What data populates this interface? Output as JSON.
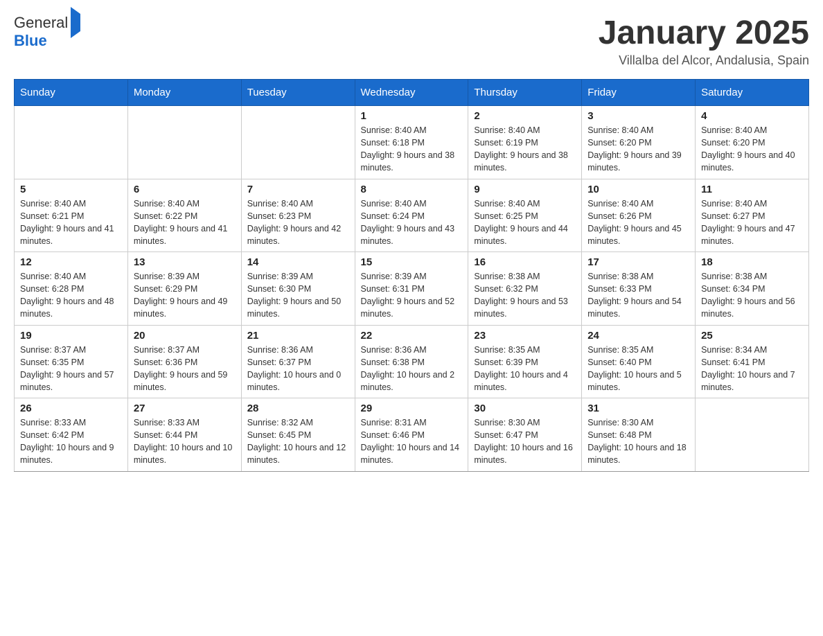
{
  "header": {
    "logo_text_general": "General",
    "logo_text_blue": "Blue",
    "month_title": "January 2025",
    "location": "Villalba del Alcor, Andalusia, Spain"
  },
  "days_of_week": [
    "Sunday",
    "Monday",
    "Tuesday",
    "Wednesday",
    "Thursday",
    "Friday",
    "Saturday"
  ],
  "weeks": [
    [
      {
        "day": "",
        "info": ""
      },
      {
        "day": "",
        "info": ""
      },
      {
        "day": "",
        "info": ""
      },
      {
        "day": "1",
        "info": "Sunrise: 8:40 AM\nSunset: 6:18 PM\nDaylight: 9 hours and 38 minutes."
      },
      {
        "day": "2",
        "info": "Sunrise: 8:40 AM\nSunset: 6:19 PM\nDaylight: 9 hours and 38 minutes."
      },
      {
        "day": "3",
        "info": "Sunrise: 8:40 AM\nSunset: 6:20 PM\nDaylight: 9 hours and 39 minutes."
      },
      {
        "day": "4",
        "info": "Sunrise: 8:40 AM\nSunset: 6:20 PM\nDaylight: 9 hours and 40 minutes."
      }
    ],
    [
      {
        "day": "5",
        "info": "Sunrise: 8:40 AM\nSunset: 6:21 PM\nDaylight: 9 hours and 41 minutes."
      },
      {
        "day": "6",
        "info": "Sunrise: 8:40 AM\nSunset: 6:22 PM\nDaylight: 9 hours and 41 minutes."
      },
      {
        "day": "7",
        "info": "Sunrise: 8:40 AM\nSunset: 6:23 PM\nDaylight: 9 hours and 42 minutes."
      },
      {
        "day": "8",
        "info": "Sunrise: 8:40 AM\nSunset: 6:24 PM\nDaylight: 9 hours and 43 minutes."
      },
      {
        "day": "9",
        "info": "Sunrise: 8:40 AM\nSunset: 6:25 PM\nDaylight: 9 hours and 44 minutes."
      },
      {
        "day": "10",
        "info": "Sunrise: 8:40 AM\nSunset: 6:26 PM\nDaylight: 9 hours and 45 minutes."
      },
      {
        "day": "11",
        "info": "Sunrise: 8:40 AM\nSunset: 6:27 PM\nDaylight: 9 hours and 47 minutes."
      }
    ],
    [
      {
        "day": "12",
        "info": "Sunrise: 8:40 AM\nSunset: 6:28 PM\nDaylight: 9 hours and 48 minutes."
      },
      {
        "day": "13",
        "info": "Sunrise: 8:39 AM\nSunset: 6:29 PM\nDaylight: 9 hours and 49 minutes."
      },
      {
        "day": "14",
        "info": "Sunrise: 8:39 AM\nSunset: 6:30 PM\nDaylight: 9 hours and 50 minutes."
      },
      {
        "day": "15",
        "info": "Sunrise: 8:39 AM\nSunset: 6:31 PM\nDaylight: 9 hours and 52 minutes."
      },
      {
        "day": "16",
        "info": "Sunrise: 8:38 AM\nSunset: 6:32 PM\nDaylight: 9 hours and 53 minutes."
      },
      {
        "day": "17",
        "info": "Sunrise: 8:38 AM\nSunset: 6:33 PM\nDaylight: 9 hours and 54 minutes."
      },
      {
        "day": "18",
        "info": "Sunrise: 8:38 AM\nSunset: 6:34 PM\nDaylight: 9 hours and 56 minutes."
      }
    ],
    [
      {
        "day": "19",
        "info": "Sunrise: 8:37 AM\nSunset: 6:35 PM\nDaylight: 9 hours and 57 minutes."
      },
      {
        "day": "20",
        "info": "Sunrise: 8:37 AM\nSunset: 6:36 PM\nDaylight: 9 hours and 59 minutes."
      },
      {
        "day": "21",
        "info": "Sunrise: 8:36 AM\nSunset: 6:37 PM\nDaylight: 10 hours and 0 minutes."
      },
      {
        "day": "22",
        "info": "Sunrise: 8:36 AM\nSunset: 6:38 PM\nDaylight: 10 hours and 2 minutes."
      },
      {
        "day": "23",
        "info": "Sunrise: 8:35 AM\nSunset: 6:39 PM\nDaylight: 10 hours and 4 minutes."
      },
      {
        "day": "24",
        "info": "Sunrise: 8:35 AM\nSunset: 6:40 PM\nDaylight: 10 hours and 5 minutes."
      },
      {
        "day": "25",
        "info": "Sunrise: 8:34 AM\nSunset: 6:41 PM\nDaylight: 10 hours and 7 minutes."
      }
    ],
    [
      {
        "day": "26",
        "info": "Sunrise: 8:33 AM\nSunset: 6:42 PM\nDaylight: 10 hours and 9 minutes."
      },
      {
        "day": "27",
        "info": "Sunrise: 8:33 AM\nSunset: 6:44 PM\nDaylight: 10 hours and 10 minutes."
      },
      {
        "day": "28",
        "info": "Sunrise: 8:32 AM\nSunset: 6:45 PM\nDaylight: 10 hours and 12 minutes."
      },
      {
        "day": "29",
        "info": "Sunrise: 8:31 AM\nSunset: 6:46 PM\nDaylight: 10 hours and 14 minutes."
      },
      {
        "day": "30",
        "info": "Sunrise: 8:30 AM\nSunset: 6:47 PM\nDaylight: 10 hours and 16 minutes."
      },
      {
        "day": "31",
        "info": "Sunrise: 8:30 AM\nSunset: 6:48 PM\nDaylight: 10 hours and 18 minutes."
      },
      {
        "day": "",
        "info": ""
      }
    ]
  ]
}
